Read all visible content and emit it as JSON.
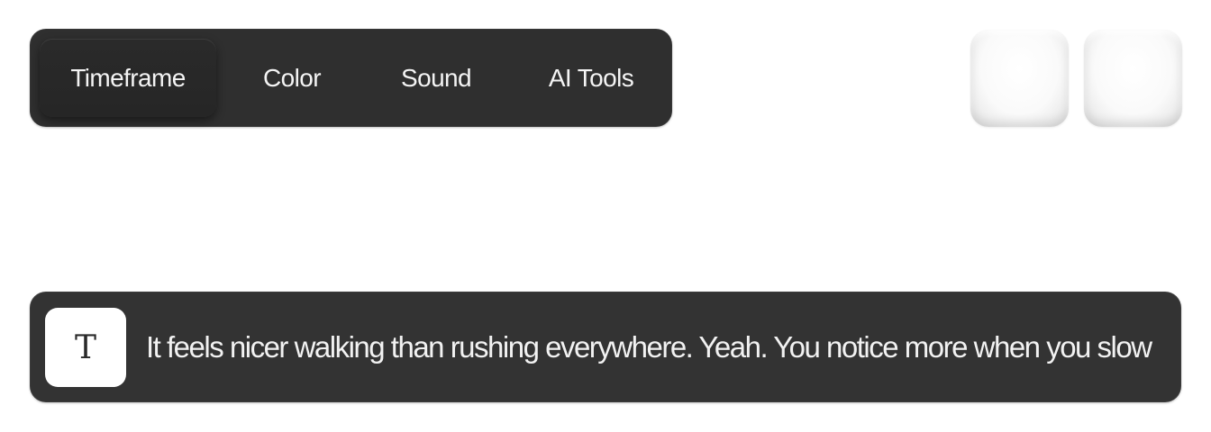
{
  "tabs": [
    {
      "label": "Timeframe",
      "active": true
    },
    {
      "label": "Color",
      "active": false
    },
    {
      "label": "Sound",
      "active": false
    },
    {
      "label": "AI Tools",
      "active": false
    }
  ],
  "transcript": {
    "icon_glyph": "T",
    "text": "It feels nicer walking than rushing everywhere. Yeah. You notice more when you slow"
  },
  "colors": {
    "bar_bg": "#2f2f2f",
    "transcript_bg": "#333333",
    "text": "#f2f2f2",
    "key_face": "#ffffff"
  }
}
